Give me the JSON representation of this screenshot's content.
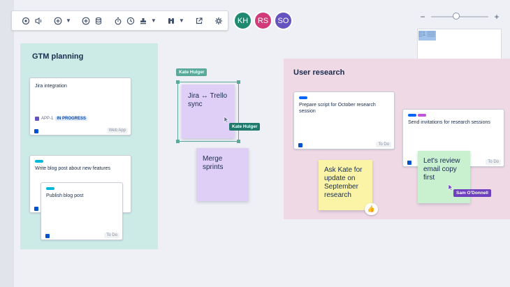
{
  "toolbar": {
    "buttons": [
      "pointer-audio",
      "add",
      "data-stack",
      "timer",
      "clock",
      "stamp",
      "binoculars",
      "export",
      "settings"
    ]
  },
  "avatars": [
    {
      "initials": "KH",
      "color": "#1f8a70"
    },
    {
      "initials": "RS",
      "color": "#d23b7a"
    },
    {
      "initials": "SO",
      "color": "#6554c0"
    }
  ],
  "zoom": {
    "minus": "−",
    "plus": "+",
    "level_fraction": 0.38
  },
  "minimap": {
    "label": "▒1 ▒▒"
  },
  "sections": {
    "gtm": {
      "title": "GTM planning",
      "color": "#cdebe6"
    },
    "research": {
      "title": "User research",
      "color": "#eed9e5"
    }
  },
  "cards": {
    "jira": {
      "title": "Jira integration",
      "issue_key": "APP-1",
      "status": "IN PROGRESS",
      "tag": "Web App"
    },
    "blog_write": {
      "title": "Write blog post about new features"
    },
    "blog_publish": {
      "title": "Publish blog post",
      "tag": "To Do"
    },
    "script": {
      "title": "Prepare script for October research session",
      "tag": "To Do"
    },
    "invites": {
      "title": "Send invitations for research sessions",
      "tag": "To Do"
    }
  },
  "stickies": {
    "jira_trello": {
      "text": "Jira ↔ Trello sync",
      "color": "#dfcff7"
    },
    "merge": {
      "text": "Merge sprints",
      "color": "#dfcff7"
    },
    "ask_kate": {
      "text": "Ask Kate for update on September research",
      "color": "#fbf4a6",
      "reaction": "👍"
    },
    "review": {
      "text": "Let's review email copy first",
      "color": "#c9f0cf"
    }
  },
  "cursors": {
    "kate_top": {
      "name": "Kate Hulger",
      "color": "#5ba99a"
    },
    "kate_side": {
      "name": "Kate Hulger",
      "color": "#1f7a6b"
    },
    "sam": {
      "name": "Sam O'Donnell",
      "color": "#6e3fbf"
    }
  }
}
